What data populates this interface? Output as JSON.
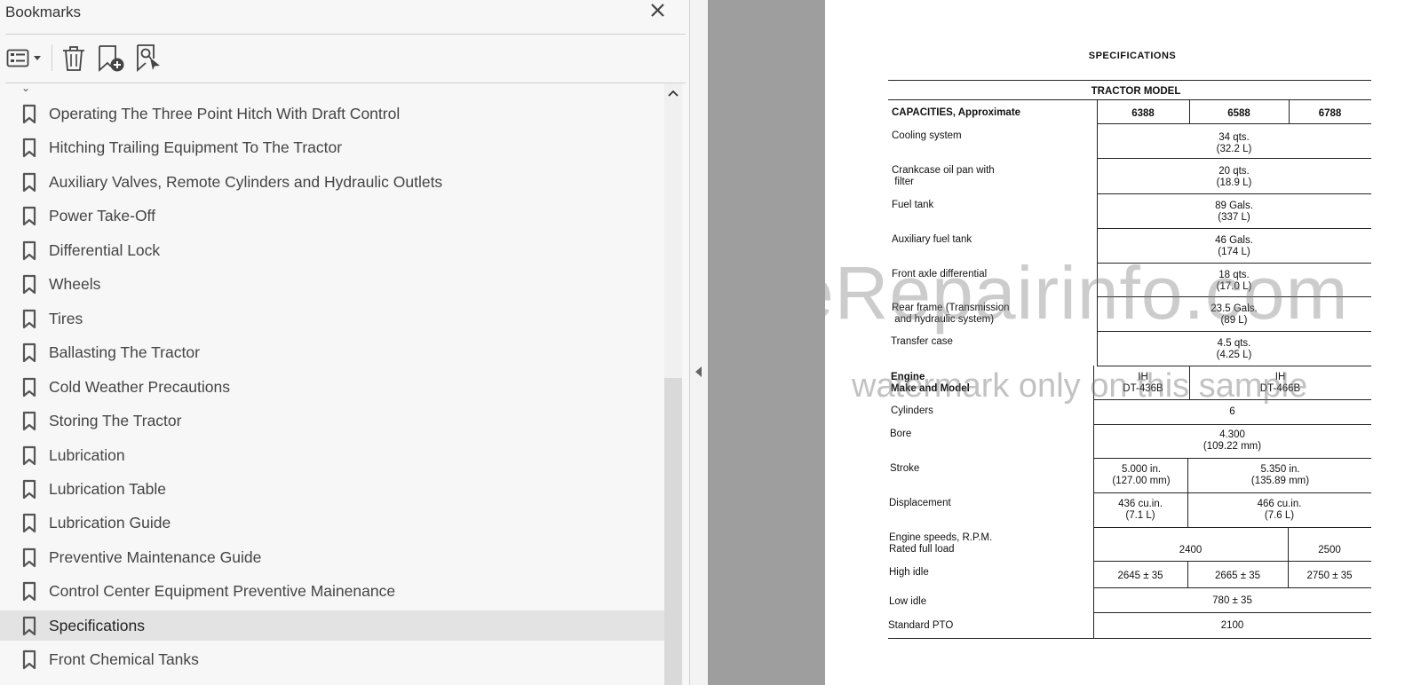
{
  "bookmarks_panel": {
    "title": "Bookmarks",
    "items": [
      {
        "label": "Operating The Three Point Hitch With Draft Control"
      },
      {
        "label": "Hitching Trailing Equipment To The Tractor"
      },
      {
        "label": "Auxiliary Valves, Remote Cylinders and Hydraulic Outlets"
      },
      {
        "label": "Power Take-Off"
      },
      {
        "label": "Differential Lock"
      },
      {
        "label": "Wheels"
      },
      {
        "label": "Tires"
      },
      {
        "label": "Ballasting The Tractor"
      },
      {
        "label": "Cold Weather Precautions"
      },
      {
        "label": "Storing The Tractor"
      },
      {
        "label": "Lubrication"
      },
      {
        "label": "Lubrication Table"
      },
      {
        "label": "Lubrication Guide"
      },
      {
        "label": "Preventive Maintenance Guide"
      },
      {
        "label": "Control Center Equipment Preventive Mainenance"
      },
      {
        "label": "Specifications",
        "selected": true
      },
      {
        "label": "Front Chemical Tanks"
      }
    ],
    "toolbar": {
      "icons": [
        "options-menu-icon",
        "delete-icon",
        "new-bookmark-icon",
        "find-current-bookmark-icon"
      ]
    }
  },
  "document": {
    "title": "SPECIFICATIONS",
    "header": "TRACTOR MODEL",
    "section_label": "CAPACITIES, Approximate",
    "models": [
      "6388",
      "6588",
      "6788"
    ],
    "rows": {
      "cooling": {
        "label": "Cooling system",
        "value1": "34 qts.",
        "value2": "(32.2 L)"
      },
      "crankcase": {
        "label": "Crankcase oil pan with\n filter",
        "value1": "20 qts.",
        "value2": "(18.9 L)"
      },
      "fuel": {
        "label": "Fuel tank",
        "value1": "89 Gals.",
        "value2": "(337 L)"
      },
      "aux_fuel": {
        "label": "Auxiliary fuel tank",
        "value1": "46 Gals.",
        "value2": "(174 L)"
      },
      "front_axle": {
        "label": "Front axle differential",
        "value1": "18 qts.",
        "value2": "(17.0 L)"
      },
      "rear_frame": {
        "label": "Rear frame (Transmission\n and hydraulic system)",
        "value1": "23.5 Gals.",
        "value2": "(89 L)"
      },
      "transfer": {
        "label": "Transfer case",
        "value1": "4.5 qts.",
        "value2": "(4.25 L)"
      },
      "engine": {
        "label": "Engine\nMake and Model",
        "a": "IH\nDT-436B",
        "b": "IH\nDT-466B"
      },
      "cylinders": {
        "label": "Cylinders",
        "value": "6"
      },
      "bore": {
        "label": "Bore",
        "value1": "4.300",
        "value2": "(109.22 mm)"
      },
      "stroke": {
        "label": "Stroke",
        "a": "5.000 in.\n(127.00 mm)",
        "b": "5.350 in.\n(135.89 mm)"
      },
      "displacement": {
        "label": "Displacement",
        "a": "436 cu.in.\n(7.1 L)",
        "b": "466 cu.in.\n(7.6 L)"
      },
      "engine_speeds": {
        "label": "Engine speeds, R.P.M.\nRated full load",
        "a": "2400",
        "b": "2500"
      },
      "high_idle": {
        "label": "High idle",
        "a": "2645 ± 35",
        "b": "2665 ± 35",
        "c": "2750 ± 35"
      },
      "low_idle": {
        "label": "Low idle",
        "value": "780 ± 35"
      },
      "pto": {
        "label": "Standard PTO",
        "value": "2100"
      }
    },
    "watermark": {
      "line1": "eRepairinfo.com",
      "line2": "watermark only on this sample"
    }
  }
}
